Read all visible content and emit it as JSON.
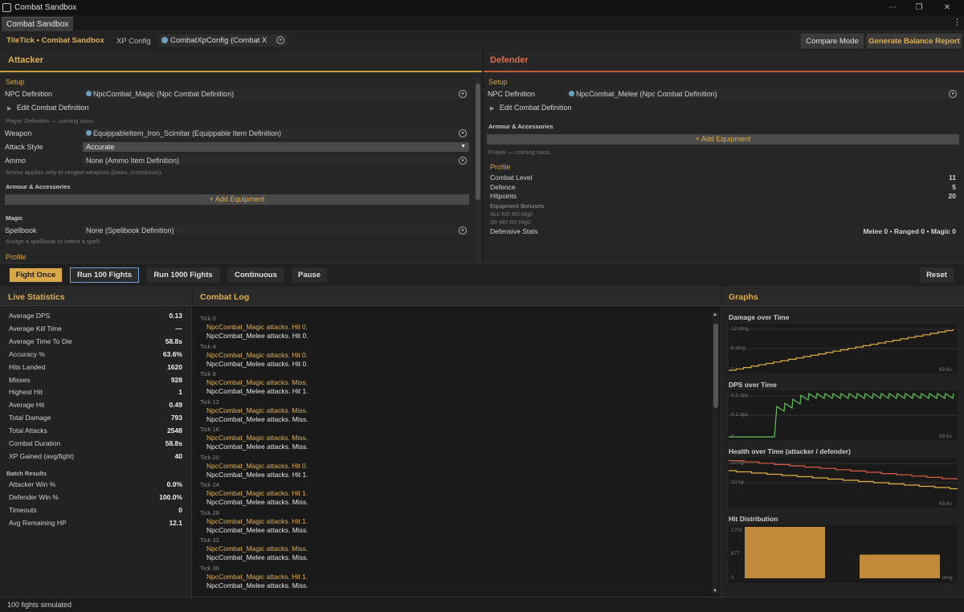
{
  "window": {
    "title": "Combat Sandbox"
  },
  "tab": {
    "label": "Combat Sandbox"
  },
  "toolbar": {
    "app": "TileTick • Combat Sandbox",
    "xp_label": "XP Config",
    "xp_value": "CombatXpConfig (Combat X",
    "compare": "Compare Mode",
    "report": "Generate Balance Report"
  },
  "attacker": {
    "title": "Attacker",
    "setup": "Setup",
    "npc_label": "NPC Definition",
    "npc_value": "NpcCombat_Magic (Npc Combat Definition)",
    "edit": "Edit Combat Definition",
    "player_note": "Player Definition — coming soon.",
    "weapon_label": "Weapon",
    "weapon_value": "EquippableItem_Iron_Scimitar (Equippable Item Definition)",
    "style_label": "Attack Style",
    "style_value": "Accurate",
    "ammo_label": "Ammo",
    "ammo_value": "None (Ammo Item Definition)",
    "ammo_note": "Ammo applies only to ranged weapons (bows, crossbows).",
    "armour": "Armour & Accessories",
    "add_equipment": "+ Add Equipment",
    "magic": "Magic",
    "spellbook_label": "Spellbook",
    "spellbook_value": "None (Spellbook Definition)",
    "spellbook_note": "Assign a spellbook to select a spell.",
    "profile": "Profile"
  },
  "defender": {
    "title": "Defender",
    "setup": "Setup",
    "npc_label": "NPC Definition",
    "npc_value": "NpcCombat_Melee (Npc Combat Definition)",
    "edit": "Edit Combat Definition",
    "armour": "Armour & Accessories",
    "add_equipment": "+ Add Equipment",
    "prayer_note": "Prayer — coming soon.",
    "profile": "Profile",
    "combat_level_label": "Combat Level",
    "combat_level": "11",
    "defence_label": "Defence",
    "defence": "5",
    "hitpoints_label": "Hitpoints",
    "hitpoints": "20",
    "bonuses_label": "Equipment Bonuses",
    "bonuses_line1": "Acc M0 R0 Mg0",
    "bonuses_line2": "Str M0 R0 Mg0",
    "def_stats_label": "Defensive Stats",
    "def_stats": "Melee 0 • Ranged 0 • Magic 0"
  },
  "controls": {
    "fight_once": "Fight Once",
    "run100": "Run 100 Fights",
    "run1000": "Run 1000 Fights",
    "continuous": "Continuous",
    "pause": "Pause",
    "reset": "Reset"
  },
  "stats": {
    "title": "Live Statistics",
    "rows": [
      {
        "label": "Average DPS",
        "value": "0.13"
      },
      {
        "label": "Average Kill Time",
        "value": "—"
      },
      {
        "label": "Average Time To Die",
        "value": "58.8s"
      },
      {
        "label": "Accuracy %",
        "value": "63.6%"
      },
      {
        "label": "Hits Landed",
        "value": "1620"
      },
      {
        "label": "Misses",
        "value": "928"
      },
      {
        "label": "Highest Hit",
        "value": "1"
      },
      {
        "label": "Average Hit",
        "value": "0.49"
      },
      {
        "label": "Total Damage",
        "value": "793"
      },
      {
        "label": "Total Attacks",
        "value": "2548"
      },
      {
        "label": "Combat Duration",
        "value": "58.8s"
      },
      {
        "label": "XP Gained (avg/fight)",
        "value": "40"
      }
    ],
    "batch_title": "Batch Results",
    "batch": [
      {
        "label": "Attacker Win %",
        "value": "0.0%"
      },
      {
        "label": "Defender Win %",
        "value": "100.0%"
      },
      {
        "label": "Timeouts",
        "value": "0"
      },
      {
        "label": "Avg Remaining HP",
        "value": "12.1"
      }
    ]
  },
  "log": {
    "title": "Combat Log",
    "entries": [
      {
        "tick": "Tick 0",
        "a": "NpcCombat_Magic attacks. Hit 0.",
        "d": "NpcCombat_Melee attacks. Hit 0."
      },
      {
        "tick": "Tick 4",
        "a": "NpcCombat_Magic attacks. Hit 0.",
        "d": "NpcCombat_Melee attacks. Hit 0."
      },
      {
        "tick": "Tick 8",
        "a": "NpcCombat_Magic attacks. Miss.",
        "d": "NpcCombat_Melee attacks. Hit 1."
      },
      {
        "tick": "Tick 12",
        "a": "NpcCombat_Magic attacks. Miss.",
        "d": "NpcCombat_Melee attacks. Miss."
      },
      {
        "tick": "Tick 16",
        "a": "NpcCombat_Magic attacks. Miss.",
        "d": "NpcCombat_Melee attacks. Miss."
      },
      {
        "tick": "Tick 20",
        "a": "NpcCombat_Magic attacks. Hit 0.",
        "d": "NpcCombat_Melee attacks. Hit 1."
      },
      {
        "tick": "Tick 24",
        "a": "NpcCombat_Magic attacks. Hit 1.",
        "d": "NpcCombat_Melee attacks. Miss."
      },
      {
        "tick": "Tick 28",
        "a": "NpcCombat_Magic attacks. Hit 1.",
        "d": "NpcCombat_Melee attacks. Miss."
      },
      {
        "tick": "Tick 32",
        "a": "NpcCombat_Magic attacks. Miss.",
        "d": "NpcCombat_Melee attacks. Miss."
      },
      {
        "tick": "Tick 36",
        "a": "NpcCombat_Magic attacks. Hit 1.",
        "d": "NpcCombat_Melee attacks. Miss."
      }
    ]
  },
  "graphs": {
    "title": "Graphs",
    "damage": {
      "title": "Damage over Time",
      "y_top": "12 dmg",
      "y_mid": "6 dmg",
      "y_zero": "0",
      "x_end": "69.6s",
      "color": "#e0b040"
    },
    "dps": {
      "title": "DPS over Time",
      "y_top": "0.2 dps",
      "y_mid": "0.1 dps",
      "y_zero": "0",
      "x_end": "69.6s",
      "color": "#5fbf5f"
    },
    "health": {
      "title": "Health over Time (attacker / defender)",
      "y_top": "20 hp",
      "y_mid": "10 hp",
      "x_end": "69.6s",
      "attacker_color": "#e0b040",
      "defender_color": "#e05a40"
    },
    "hits": {
      "title": "Hit Distribution",
      "y_top": "1755",
      "y_mid": "877",
      "y_zero": "0",
      "x_unit": "dmg",
      "bars": [
        1755,
        808
      ],
      "color": "#c08a3a"
    }
  },
  "status": {
    "text": "100 fights simulated"
  }
}
